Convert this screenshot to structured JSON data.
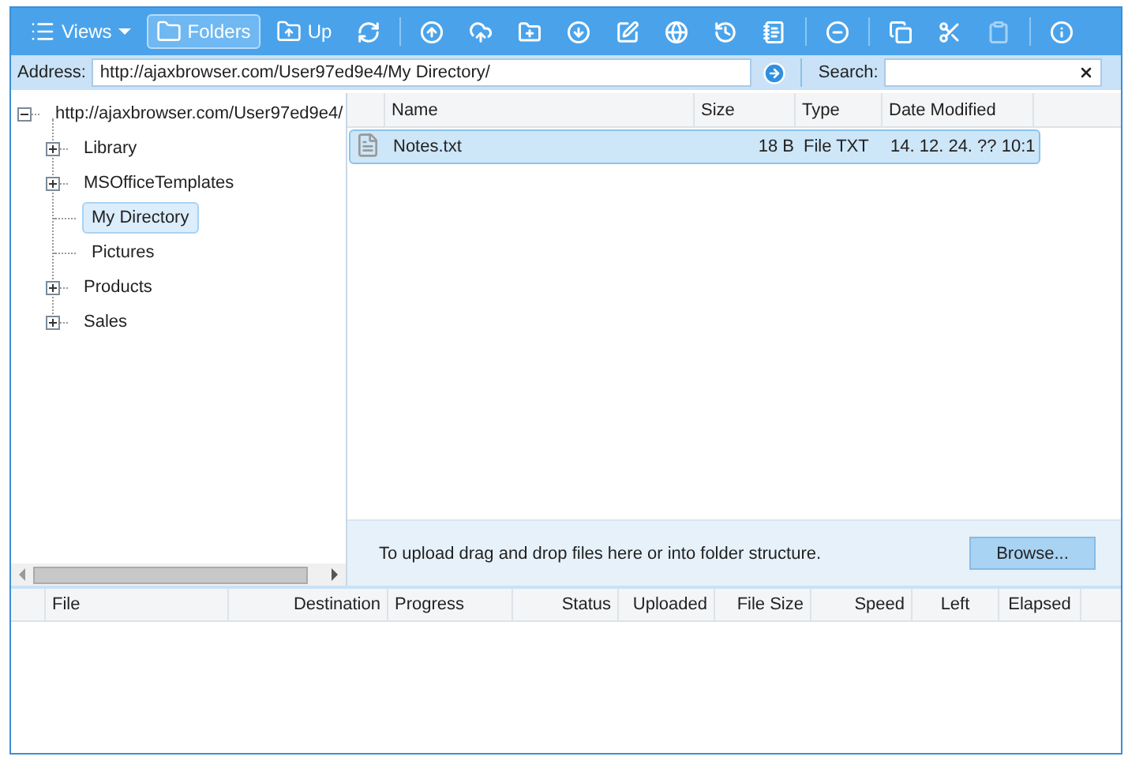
{
  "toolbar": {
    "buttons": [
      {
        "kind": "menu",
        "label": "Views",
        "selected": false
      },
      {
        "kind": "toggle",
        "label": "Folders",
        "selected": true
      },
      {
        "kind": "text",
        "label": "Up"
      },
      {
        "kind": "icon",
        "disabled": false
      },
      {
        "kind": "separator"
      },
      {
        "kind": "icon",
        "disabled": false
      },
      {
        "kind": "icon",
        "disabled": false
      },
      {
        "kind": "icon",
        "disabled": false
      },
      {
        "kind": "icon",
        "disabled": false
      },
      {
        "kind": "icon",
        "disabled": false
      },
      {
        "kind": "icon",
        "disabled": false
      },
      {
        "kind": "icon",
        "disabled": false
      },
      {
        "kind": "icon",
        "disabled": false
      },
      {
        "kind": "separator"
      },
      {
        "kind": "icon",
        "disabled": false
      },
      {
        "kind": "separator"
      },
      {
        "kind": "icon",
        "disabled": false
      },
      {
        "kind": "icon",
        "disabled": false
      },
      {
        "kind": "icon",
        "disabled": true
      },
      {
        "kind": "separator"
      },
      {
        "kind": "icon",
        "disabled": false
      }
    ]
  },
  "address_bar": {
    "label": "Address:",
    "value": "http://ajaxbrowser.com/User97ed9e4/My Directory/",
    "search_label": "Search:"
  },
  "folder_tree": {
    "label": "http://ajaxbrowser.com/User97ed9e4/",
    "expanded": true,
    "selected": false,
    "children": [
      {
        "label": "Library",
        "expandable": true,
        "selected": false
      },
      {
        "label": "MSOfficeTemplates",
        "expandable": true,
        "selected": false
      },
      {
        "label": "My Directory",
        "expandable": false,
        "selected": true
      },
      {
        "label": "Pictures",
        "expandable": false,
        "selected": false
      },
      {
        "label": "Products",
        "expandable": true,
        "selected": false
      },
      {
        "label": "Sales",
        "expandable": true,
        "selected": false
      }
    ]
  },
  "file_list": {
    "columns": [
      "Name",
      "Size",
      "Type",
      "Date Modified"
    ],
    "rows": [
      {
        "name": "Notes.txt",
        "size": "18 B",
        "type": "File TXT",
        "date_modified": "14. 12. 24. ?? 10:1",
        "selected": true
      }
    ]
  },
  "upload_area": {
    "hint": "To upload drag and drop files here or into folder structure.",
    "button": "Browse..."
  },
  "transfer_table": {
    "columns": [
      "File",
      "Destination",
      "Progress",
      "Status",
      "Uploaded",
      "File Size",
      "Speed",
      "Left",
      "Elapsed"
    ]
  }
}
